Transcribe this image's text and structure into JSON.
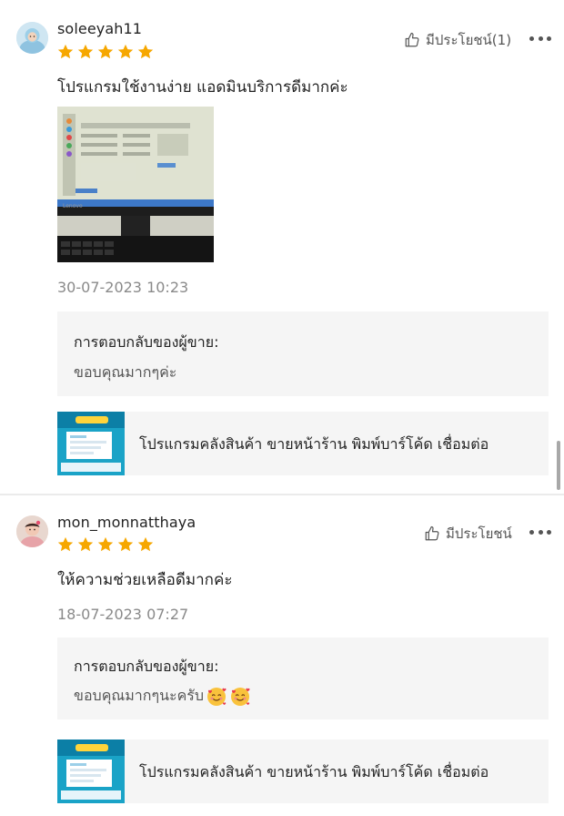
{
  "reviews": [
    {
      "username": "soleeyah11",
      "rating": 5,
      "helpful_label": "มีประโยชน์(1)",
      "comment": "โปรแกรมใช้งานง่าย แอดมินบริการดีมากค่ะ",
      "photo_caption": "Lenovo",
      "datetime": "30-07-2023 10:23",
      "seller_reply_title": "การตอบกลับของผู้ขาย:",
      "seller_reply_text": "ขอบคุณมากๆค่ะ",
      "product_name": "โปรแกรมคลังสินค้า ขายหน้าร้าน พิมพ์บาร์โค้ด เชื่อมต่อ"
    },
    {
      "username": "mon_monnatthaya",
      "rating": 5,
      "helpful_label": "มีประโยชน์",
      "comment": "ให้ความช่วยเหลือดีมากค่ะ",
      "datetime": "18-07-2023 07:27",
      "seller_reply_title": "การตอบกลับของผู้ขาย:",
      "seller_reply_text": "ขอบคุณมากๆนะครับ",
      "seller_reply_emojis": [
        "smiling-face-with-hearts",
        "smiling-face-with-hearts"
      ],
      "product_name": "โปรแกรมคลังสินค้า ขายหน้าร้าน พิมพ์บาร์โค้ด เชื่อมต่อ"
    }
  ],
  "colors": {
    "star": "#f6a700",
    "seller_box_bg": "#f5f5f5",
    "muted_text": "#8a8a8a",
    "divider": "#ebebeb",
    "product_thumb": "#1aa3c7"
  },
  "icons": {
    "helpful": "thumbs-up-outline-icon",
    "more": "more-horizontal-icon",
    "star": "star-filled-icon"
  }
}
